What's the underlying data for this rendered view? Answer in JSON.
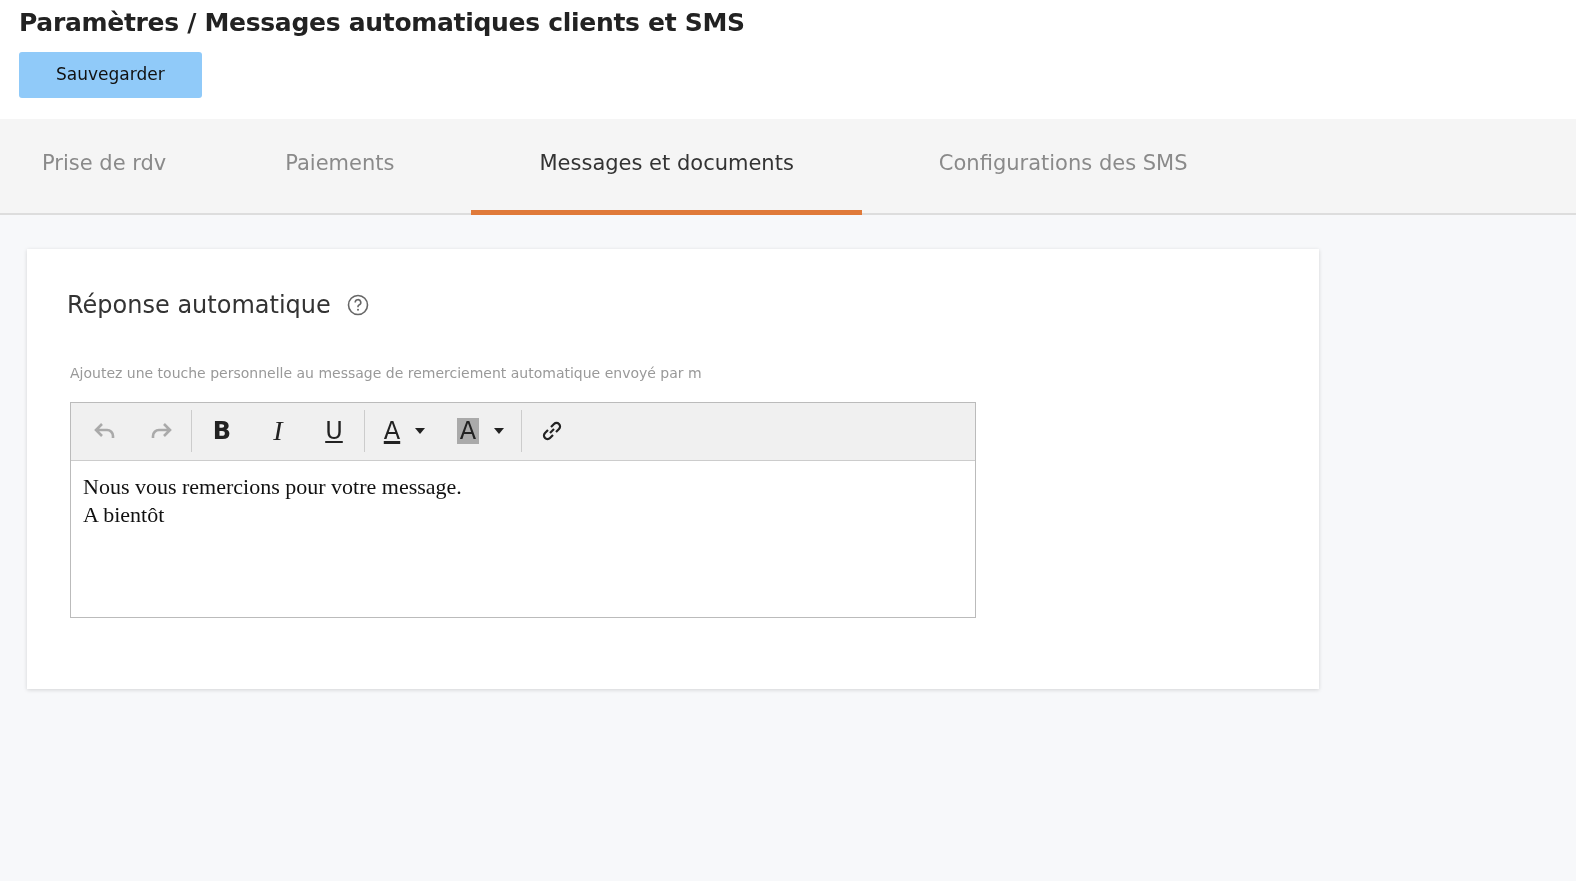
{
  "page_title": "Paramètres / Messages automatiques clients et SMS",
  "save_button": "Sauvegarder",
  "tabs": [
    {
      "label": "Prise de rdv",
      "selected": false
    },
    {
      "label": "Paiements",
      "selected": false
    },
    {
      "label": "Messages et documents",
      "selected": true
    },
    {
      "label": "Configurations des SMS",
      "selected": false
    }
  ],
  "card": {
    "title": "Réponse automatique",
    "hint": "Ajoutez une touche personnelle au message de remerciement automatique envoyé par m",
    "toolbar": [
      {
        "kind": "undo",
        "disabled": true
      },
      {
        "kind": "redo",
        "disabled": true
      },
      {
        "kind": "separator"
      },
      {
        "kind": "bold",
        "label": "B",
        "disabled": false
      },
      {
        "kind": "italic",
        "label": "I",
        "disabled": false
      },
      {
        "kind": "underline",
        "label": "U",
        "disabled": false
      },
      {
        "kind": "separator"
      },
      {
        "kind": "text-color",
        "label": "A",
        "disabled": false
      },
      {
        "kind": "highlight",
        "label": "A",
        "disabled": false
      },
      {
        "kind": "separator"
      },
      {
        "kind": "link",
        "disabled": false
      }
    ],
    "editor_lines": [
      "Nous vous remercions pour votre message.",
      "A bientôt"
    ]
  }
}
